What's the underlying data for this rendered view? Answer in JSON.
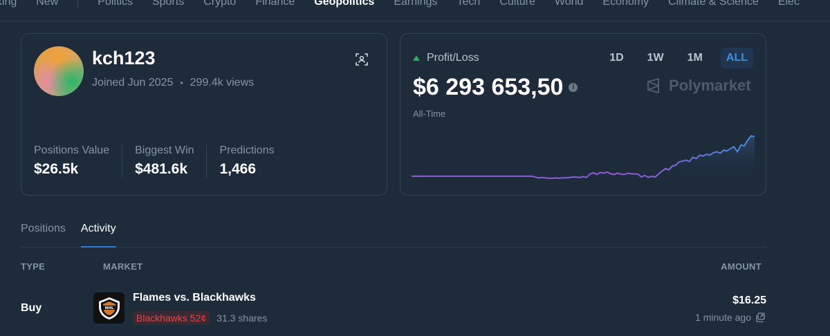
{
  "nav": {
    "items": [
      {
        "label": "aking",
        "active": false
      },
      {
        "label": "New",
        "active": false
      },
      {
        "label": "Politics",
        "active": false
      },
      {
        "label": "Sports",
        "active": false
      },
      {
        "label": "Crypto",
        "active": false
      },
      {
        "label": "Finance",
        "active": false
      },
      {
        "label": "Geopolitics",
        "active": true
      },
      {
        "label": "Earnings",
        "active": false
      },
      {
        "label": "Tech",
        "active": false
      },
      {
        "label": "Culture",
        "active": false
      },
      {
        "label": "World",
        "active": false
      },
      {
        "label": "Economy",
        "active": false
      },
      {
        "label": "Climate & Science",
        "active": false
      },
      {
        "label": "Elec",
        "active": false
      }
    ]
  },
  "profile": {
    "username": "kch123",
    "joined": "Joined Jun 2025",
    "dot": "•",
    "views": "299.4k views",
    "stats": [
      {
        "label": "Positions Value",
        "value": "$26.5k"
      },
      {
        "label": "Biggest Win",
        "value": "$481.6k"
      },
      {
        "label": "Predictions",
        "value": "1,466"
      }
    ]
  },
  "pnl": {
    "title": "Profit/Loss",
    "value": "$6 293 653,50",
    "info": "i",
    "subtitle": "All-Time",
    "brand": "Polymarket",
    "ranges": [
      {
        "label": "1D",
        "active": false
      },
      {
        "label": "1W",
        "active": false
      },
      {
        "label": "1M",
        "active": false
      },
      {
        "label": "ALL",
        "active": true
      }
    ],
    "colors": {
      "line_start": "#8f5bd9",
      "line_end": "#3d8fe0",
      "positive": "#27ae60"
    }
  },
  "tabs": [
    {
      "label": "Positions",
      "active": false
    },
    {
      "label": "Activity",
      "active": true
    }
  ],
  "table": {
    "headers": {
      "type": "TYPE",
      "market": "MARKET",
      "amount": "AMOUNT"
    },
    "rows": [
      {
        "type": "Buy",
        "market": "Flames vs. Blackhawks",
        "outcome": "Blackhawks 52¢",
        "shares": "31.3 shares",
        "amount": "$16.25",
        "time": "1 minute ago"
      }
    ]
  },
  "chart_data": {
    "type": "line",
    "title": "",
    "xlabel": "",
    "ylabel": "",
    "x": [
      0,
      1,
      2,
      3,
      4,
      5,
      6,
      7,
      8,
      9,
      10,
      11,
      12,
      13,
      14,
      15,
      16,
      17,
      18,
      19,
      20,
      21,
      22,
      23,
      24,
      25,
      26,
      27,
      28,
      29,
      30,
      31,
      32,
      33,
      34,
      35,
      36,
      37,
      38,
      39,
      40,
      41,
      42,
      43,
      44,
      45,
      46,
      47,
      48,
      49,
      50,
      51,
      52,
      53,
      54,
      55,
      56,
      57,
      58,
      59,
      60,
      61,
      62,
      63,
      64,
      65,
      66,
      67,
      68,
      69,
      70,
      71,
      72,
      73,
      74,
      75,
      76,
      77,
      78,
      79,
      80,
      81,
      82,
      83,
      84,
      85,
      86,
      87,
      88,
      89,
      90,
      91,
      92,
      93,
      94,
      95,
      96,
      97,
      98,
      99,
      100
    ],
    "values": [
      0,
      0,
      0,
      0,
      0,
      0,
      0,
      0,
      0,
      0,
      0,
      0,
      0,
      0,
      0,
      0,
      0,
      0,
      0,
      0,
      0,
      0,
      0,
      0,
      0,
      0,
      0,
      0,
      0,
      0,
      0,
      0,
      0,
      0,
      0,
      0,
      -0.02,
      -0.04,
      -0.03,
      -0.04,
      -0.05,
      -0.05,
      -0.04,
      -0.05,
      -0.04,
      -0.04,
      -0.03,
      -0.02,
      -0.02,
      -0.03,
      -0.01,
      -0.03,
      0.05,
      0.08,
      0.04,
      0.09,
      0.07,
      0.1,
      0.06,
      0.04,
      0.07,
      0.05,
      0.04,
      0.07,
      0.06,
      0.05,
      0.05,
      -0.02,
      0.02,
      -0.03,
      0.0,
      -0.02,
      0.05,
      0.12,
      0.18,
      0.15,
      0.24,
      0.26,
      0.34,
      0.36,
      0.38,
      0.35,
      0.45,
      0.42,
      0.5,
      0.48,
      0.52,
      0.5,
      0.56,
      0.58,
      0.55,
      0.62,
      0.6,
      0.66,
      0.7,
      0.58,
      0.74,
      0.72,
      0.86,
      0.96,
      0.94
    ],
    "ylim": [
      -0.15,
      1.0
    ],
    "grid": false,
    "legend": "none"
  }
}
